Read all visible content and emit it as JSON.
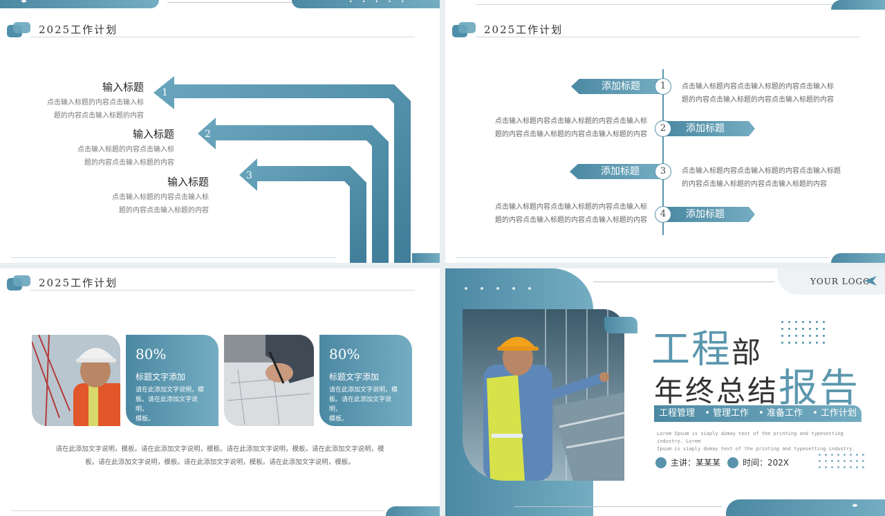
{
  "header": {
    "title": "2025工作计划"
  },
  "slide1": {
    "items": [
      {
        "num": "1",
        "title": "输入标题",
        "desc1": "点击输入标题的内容点击输入标",
        "desc2": "题的内容点击输入标题的内容"
      },
      {
        "num": "2",
        "title": "输入标题",
        "desc1": "点击输入标题的内容点击输入标",
        "desc2": "题的内容点击输入标题的内容"
      },
      {
        "num": "3",
        "title": "输入标题",
        "desc1": "点击输入标题的内容点击输入标",
        "desc2": "题的内容点击输入标题的内容"
      }
    ]
  },
  "slide2": {
    "items": [
      {
        "num": "1",
        "tag": "添加标题",
        "desc1": "点击输入标题内容点击输入标题的内容点击输入标",
        "desc2": "题的内容点击输入标题的内容点击输入标题的内容"
      },
      {
        "num": "2",
        "tag": "添加标题",
        "desc1": "点击输入标题内容点击输入标题的内容点击输入标",
        "desc2": "题的内容点击输入标题的内容点击输入标题的内容"
      },
      {
        "num": "3",
        "tag": "添加标题",
        "desc1": "点击输入标题内容点击输入标题的内容点击输入标题",
        "desc2": "的内容点击输入标题的内容点击输入标题的内容"
      },
      {
        "num": "4",
        "tag": "添加标题",
        "desc1": "点击输入标题内容点击输入标题的内容点击输入标",
        "desc2": "题的内容点击输入标题的内容点击输入标题的内容"
      }
    ]
  },
  "slide3": {
    "cards": [
      {
        "pct": "80%",
        "title": "标题文字添加",
        "desc1": "请在此添加文字说明，模",
        "desc2": "板。请在此添加文字说明，",
        "desc3": "模板。"
      },
      {
        "pct": "80%",
        "title": "标题文字添加",
        "desc1": "请在此添加文字说明，模",
        "desc2": "板。请在此添加文字说明，",
        "desc3": "模板。"
      }
    ],
    "footer1": "请在此添加文字说明，模板。请在此添加文字说明，模板。请在此添加文字说明，模板。请在此添加文字说明，模",
    "footer2": "板。请在此添加文字说明，模板。请在此添加文字说明，模板。请在此添加文字说明，模板。"
  },
  "slide4": {
    "logo": "YOUR LOGO",
    "title1_accent": "工程",
    "title1_dark": "部",
    "title2_dark": "年终总结",
    "title2_accent": "报告",
    "tags": [
      "工程管理",
      "• 管理工作",
      "• 准备工作",
      "• 工作计划"
    ],
    "lorem1": "Lorem Ipsum is siaply dumay text of the printing and typesetting industry. Lorem",
    "lorem2": "Ipsum is siaply dumay text of the printing and typesetting industry.",
    "speaker": "主讲：某某某",
    "time": "时间：202X"
  },
  "colors": {
    "accent": "#5b97ae",
    "accent_dark": "#4b88a2"
  }
}
